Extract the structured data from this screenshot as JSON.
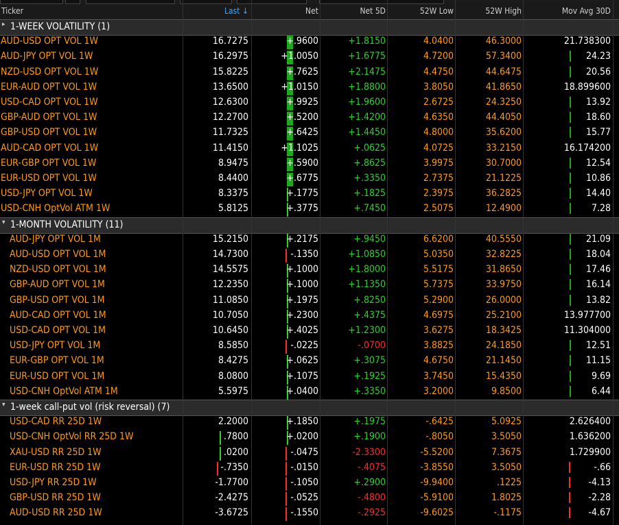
{
  "columns": {
    "ticker": "Ticker",
    "last": "Last ↓",
    "net": "Net",
    "net5d": "Net 5D",
    "low52": "52W Low",
    "high52": "52W High",
    "mavg30": "Mov Avg 30D"
  },
  "colors": {
    "ticker": "#ff9a1a",
    "positive": "#2fd12f",
    "negative": "#ff2a2a",
    "bar_green": "#2fd12f",
    "bar_red": "#ff2a2a"
  },
  "groups": [
    {
      "title": "1-WEEK VOLATILITY (1)",
      "expanded": false,
      "rows": [
        {
          "ticker": "AUD-USD OPT VOL 1W",
          "last": "16.7275",
          "net": "+.9600",
          "net5d": "+1.8150",
          "low": "4.0400",
          "high": "46.3000",
          "mavg": "21.738300",
          "netbar": "pos",
          "mtick": "none"
        },
        {
          "ticker": "AUD-JPY OPT VOL 1W",
          "last": "16.2975",
          "net": "+1.0050",
          "net5d": "+1.6775",
          "low": "4.7200",
          "high": "57.3400",
          "mavg": "24.23",
          "netbar": "pos",
          "mtick": "green"
        },
        {
          "ticker": "NZD-USD OPT VOL 1W",
          "last": "15.8225",
          "net": "+.7625",
          "net5d": "+2.1475",
          "low": "4.4750",
          "high": "44.6475",
          "mavg": "20.56",
          "netbar": "pos",
          "mtick": "green"
        },
        {
          "ticker": "EUR-AUD OPT VOL 1W",
          "last": "13.6500",
          "net": "+1.0150",
          "net5d": "+1.8800",
          "low": "3.8050",
          "high": "41.8650",
          "mavg": "18.899600",
          "netbar": "pos",
          "mtick": "none"
        },
        {
          "ticker": "USD-CAD OPT VOL 1W",
          "last": "12.6300",
          "net": "+.9925",
          "net5d": "+1.9600",
          "low": "2.6725",
          "high": "24.3250",
          "mavg": "13.92",
          "netbar": "pos",
          "mtick": "green"
        },
        {
          "ticker": "GBP-AUD OPT VOL 1W",
          "last": "12.2700",
          "net": "+.5200",
          "net5d": "+1.4200",
          "low": "4.6350",
          "high": "44.4050",
          "mavg": "18.60",
          "netbar": "pos",
          "mtick": "green"
        },
        {
          "ticker": "GBP-USD OPT VOL 1W",
          "last": "11.7325",
          "net": "+.6425",
          "net5d": "+1.4450",
          "low": "4.8000",
          "high": "35.6200",
          "mavg": "15.77",
          "netbar": "pos",
          "mtick": "green"
        },
        {
          "ticker": "AUD-CAD OPT VOL 1W",
          "last": "11.4150",
          "net": "+1.1025",
          "net5d": "+.0625",
          "low": "4.0725",
          "high": "33.2150",
          "mavg": "16.174200",
          "netbar": "pos",
          "mtick": "none"
        },
        {
          "ticker": "EUR-GBP OPT VOL 1W",
          "last": "8.9475",
          "net": "+.5900",
          "net5d": "+.8625",
          "low": "3.9975",
          "high": "30.7000",
          "mavg": "12.54",
          "netbar": "pos",
          "mtick": "green"
        },
        {
          "ticker": "EUR-USD OPT VOL 1W",
          "last": "8.4400",
          "net": "+.6775",
          "net5d": "+.3350",
          "low": "2.7375",
          "high": "21.1225",
          "mavg": "10.86",
          "netbar": "pos",
          "mtick": "green"
        },
        {
          "ticker": "USD-JPY OPT VOL 1W",
          "last": "8.3375",
          "net": "+.1775",
          "net5d": "+.1825",
          "low": "2.3975",
          "high": "36.2825",
          "mavg": "14.40",
          "netbar": "thin",
          "mtick": "green"
        },
        {
          "ticker": "USD-CNH OptVol ATM 1W",
          "last": "5.8125",
          "net": "+.3775",
          "net5d": "+.7450",
          "low": "2.5075",
          "high": "12.4900",
          "mavg": "7.28",
          "netbar": "thin",
          "mtick": "green"
        }
      ]
    },
    {
      "title": "1-MONTH VOLATILITY (11)",
      "expanded": true,
      "rows": [
        {
          "ticker": "AUD-JPY OPT VOL 1M",
          "last": "15.2150",
          "net": "+.2175",
          "net5d": "+.9450",
          "low": "6.6200",
          "high": "40.5550",
          "mavg": "21.09",
          "netbar": "thin",
          "mtick": "green"
        },
        {
          "ticker": "AUD-USD OPT VOL 1M",
          "last": "14.7300",
          "net": "-.1350",
          "net5d": "+1.0850",
          "low": "5.0350",
          "high": "32.8225",
          "mavg": "18.04",
          "netbar": "thinred",
          "mtick": "green"
        },
        {
          "ticker": "NZD-USD OPT VOL 1M",
          "last": "14.5575",
          "net": "+.1000",
          "net5d": "+1.8000",
          "low": "5.5175",
          "high": "31.8650",
          "mavg": "17.46",
          "netbar": "thin",
          "mtick": "green"
        },
        {
          "ticker": "GBP-AUD OPT VOL 1M",
          "last": "12.2350",
          "net": "+.1000",
          "net5d": "+1.1350",
          "low": "5.7375",
          "high": "33.9750",
          "mavg": "16.14",
          "netbar": "thin",
          "mtick": "green"
        },
        {
          "ticker": "GBP-USD OPT VOL 1M",
          "last": "11.0850",
          "net": "+.1975",
          "net5d": "+.8250",
          "low": "5.2900",
          "high": "26.0000",
          "mavg": "13.82",
          "netbar": "thin",
          "mtick": "green"
        },
        {
          "ticker": "AUD-CAD OPT VOL 1M",
          "last": "10.7050",
          "net": "+.2300",
          "net5d": "+.4375",
          "low": "4.6975",
          "high": "25.2100",
          "mavg": "13.977700",
          "netbar": "thin",
          "mtick": "none"
        },
        {
          "ticker": "USD-CAD OPT VOL 1M",
          "last": "10.6450",
          "net": "+.4025",
          "net5d": "+1.2300",
          "low": "3.6275",
          "high": "18.3425",
          "mavg": "11.304000",
          "netbar": "thin",
          "mtick": "none"
        },
        {
          "ticker": "USD-JPY OPT VOL 1M",
          "last": "8.5850",
          "net": "-.0225",
          "net5d": "-.0700",
          "low": "3.8825",
          "high": "24.1850",
          "mavg": "12.51",
          "netbar": "thinred",
          "mtick": "green"
        },
        {
          "ticker": "EUR-GBP OPT VOL 1M",
          "last": "8.4275",
          "net": "+.0625",
          "net5d": "+.3075",
          "low": "4.6750",
          "high": "21.1450",
          "mavg": "11.15",
          "netbar": "thin",
          "mtick": "green"
        },
        {
          "ticker": "EUR-USD OPT VOL 1M",
          "last": "8.0800",
          "net": "+.1075",
          "net5d": "+.1925",
          "low": "3.7450",
          "high": "15.4350",
          "mavg": "9.69",
          "netbar": "thin",
          "mtick": "green"
        },
        {
          "ticker": "USD-CNH OptVol ATM 1M",
          "last": "5.5975",
          "net": "+.0400",
          "net5d": "+.3350",
          "low": "3.2000",
          "high": "9.8500",
          "mavg": "6.44",
          "netbar": "thin",
          "mtick": "green"
        }
      ]
    },
    {
      "title": "1-week call-put vol (risk reversal) (7)",
      "expanded": true,
      "rows": [
        {
          "ticker": "USD-CAD RR 25D 1W",
          "last": "2.2000",
          "net": "+.1850",
          "net5d": "+.1975",
          "low": "-.6425",
          "high": "5.0925",
          "mavg": "2.626400",
          "netbar": "thin",
          "mtick": "none",
          "lastbar": "none"
        },
        {
          "ticker": "USD-CNH OptVol RR 25D 1W",
          "last": ".7800",
          "net": "+.0200",
          "net5d": "+.1900",
          "low": "-.8050",
          "high": "3.5050",
          "mavg": "1.636200",
          "netbar": "thin",
          "mtick": "none",
          "lastbar": "green"
        },
        {
          "ticker": "XAU-USD RR 25D 1W",
          "last": ".0200",
          "net": "-.0475",
          "net5d": "-2.3300",
          "low": "-5.5200",
          "high": "7.3675",
          "mavg": "1.729900",
          "netbar": "thinred",
          "mtick": "none",
          "lastbar": "green"
        },
        {
          "ticker": "EUR-USD RR 25D 1W",
          "last": "-.7350",
          "net": "-.0150",
          "net5d": "-.4075",
          "low": "-3.8550",
          "high": "3.5050",
          "mavg": "-.66",
          "netbar": "thinred",
          "mtick": "red",
          "lastbar": "red"
        },
        {
          "ticker": "USD-JPY RR 25D 1W",
          "last": "-1.7700",
          "net": "-.1050",
          "net5d": "+.2900",
          "low": "-9.9400",
          "high": ".1225",
          "mavg": "-4.13",
          "netbar": "thinred",
          "mtick": "red",
          "lastbar": "none"
        },
        {
          "ticker": "GBP-USD RR 25D 1W",
          "last": "-2.4275",
          "net": "-.0525",
          "net5d": "-.4800",
          "low": "-5.9100",
          "high": "1.8025",
          "mavg": "-2.28",
          "netbar": "thinred",
          "mtick": "red",
          "lastbar": "none"
        },
        {
          "ticker": "AUD-USD RR 25D 1W",
          "last": "-3.6725",
          "net": "-.1550",
          "net5d": "-.2925",
          "low": "-9.6025",
          "high": "-.1175",
          "mavg": "-4.67",
          "netbar": "thinred",
          "mtick": "red",
          "lastbar": "none"
        }
      ]
    }
  ]
}
